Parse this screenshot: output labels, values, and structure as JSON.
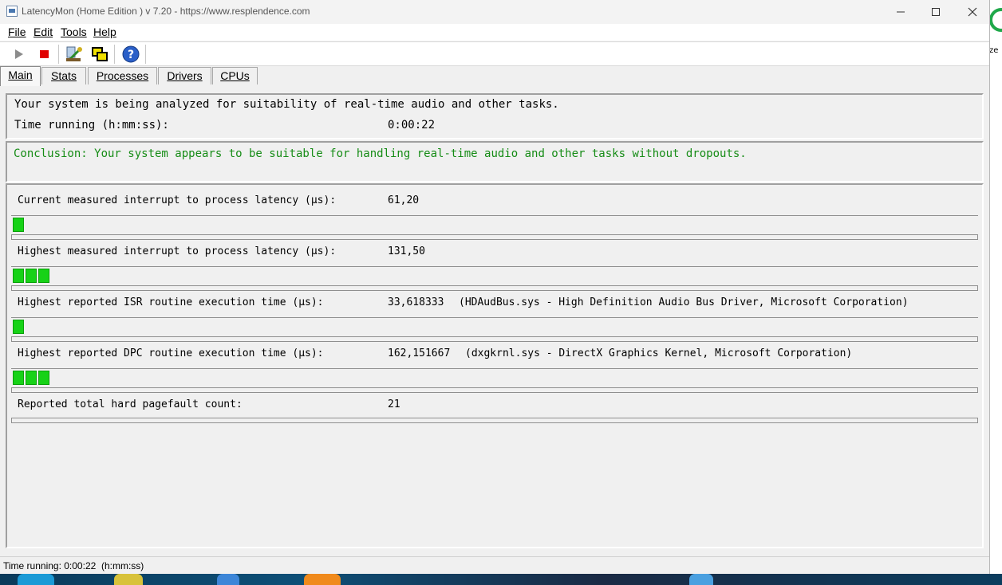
{
  "window": {
    "title": "LatencyMon  (Home Edition )  v 7.20 - https://www.resplendence.com",
    "controls": {
      "minimize": "—",
      "maximize": "☐",
      "close": "✕"
    }
  },
  "menu": [
    {
      "label": "File"
    },
    {
      "label": "Edit"
    },
    {
      "label": "Tools"
    },
    {
      "label": "Help"
    }
  ],
  "toolbar": {
    "buttons": [
      "play-icon",
      "stop-icon",
      "tools-wizard-icon",
      "windows-icon",
      "help-icon"
    ],
    "help_glyph": "?"
  },
  "tabs": [
    {
      "label": "Main",
      "active": true
    },
    {
      "label": "Stats"
    },
    {
      "label": "Processes"
    },
    {
      "label": "Drivers"
    },
    {
      "label": "CPUs"
    }
  ],
  "status": {
    "analyzing": "Your system is being analyzed for suitability of real-time audio and other tasks.",
    "time_label": "Time running (h:mm:ss):",
    "time_value": "0:00:22"
  },
  "conclusion": {
    "text": "Conclusion: Your system appears to be suitable for handling real-time audio and other tasks without dropouts.",
    "color": "#168c16"
  },
  "metrics": [
    {
      "label": "Current measured interrupt to process latency (µs):",
      "value": "61,20",
      "detail": "",
      "bar_segments": 1
    },
    {
      "label": "Highest measured interrupt to process latency (µs):",
      "value": "131,50",
      "detail": "",
      "bar_segments": 3
    },
    {
      "label": "Highest reported ISR routine execution time (µs):",
      "value": "33,618333",
      "detail": "(HDAudBus.sys - High Definition Audio Bus Driver, Microsoft Corporation)",
      "bar_segments": 1
    },
    {
      "label": "Highest reported DPC routine execution time (µs):",
      "value": "162,151667",
      "detail": "(dxgkrnl.sys - DirectX Graphics Kernel, Microsoft Corporation)",
      "bar_segments": 3
    },
    {
      "label": "Reported total hard pagefault count:",
      "value": "21",
      "detail": ""
    }
  ],
  "statusbar": {
    "text": "Time running: 0:00:22  (h:mm:ss)"
  },
  "desktop": {
    "partial_text": "ze"
  },
  "colors": {
    "bar_fill": "#17d217",
    "window_bg": "#f0f0f0"
  }
}
